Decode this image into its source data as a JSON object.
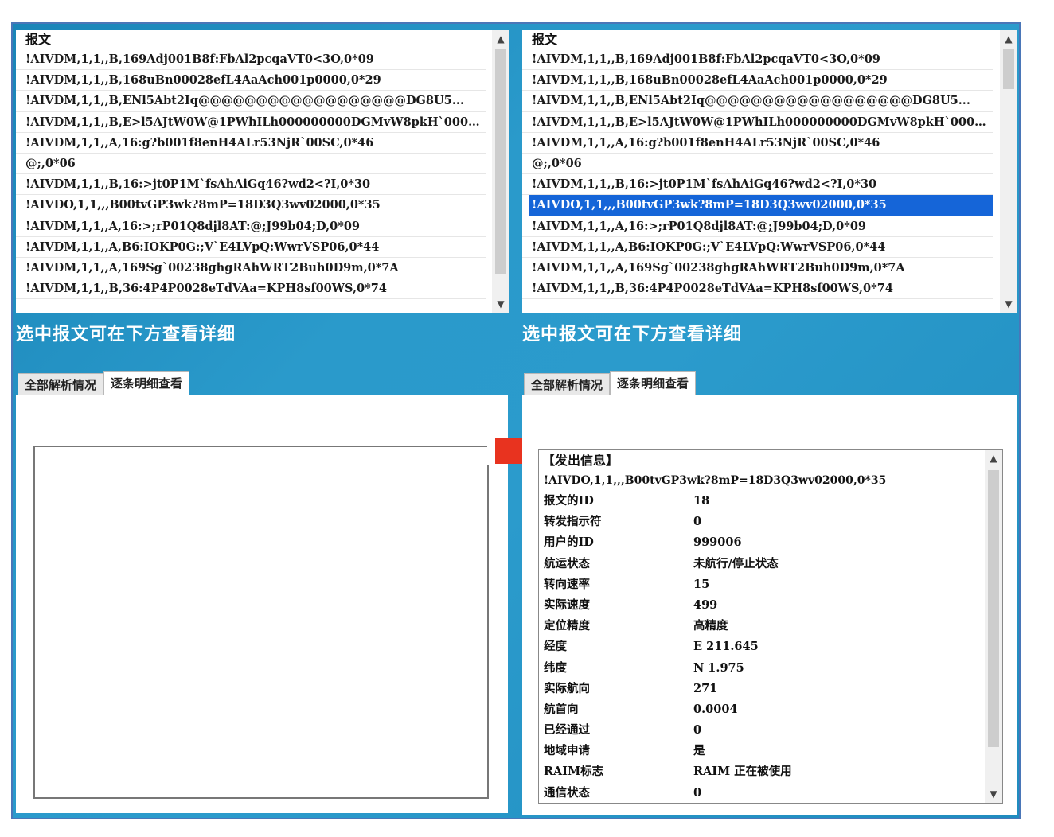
{
  "left_panel": {
    "list_header": "报文",
    "messages": [
      "!AIVDM,1,1,,B,169Adj001B8f:FbAl2pcqaVT0<3O,0*09",
      "!AIVDM,1,1,,B,168uBn00028efL4AaAch001p0000,0*29",
      "!AIVDM,1,1,,B,ENl5Abt2Iq@@@@@@@@@@@@@@@@@@DG8U5...",
      "!AIVDM,1,1,,B,E>l5AJtW0W@1PWhILh000000000DGMvW8pkH`0000...",
      "!AIVDM,1,1,,A,16:g?b001f8enH4ALr53NjR`00SC,0*46",
      "@;,0*06",
      "!AIVDM,1,1,,B,16:>jt0P1M`fsAhAiGq46?wd2<?I,0*30",
      "!AIVDO,1,1,,,B00tvGP3wk?8mP=18D3Q3wv02000,0*35",
      "!AIVDM,1,1,,A,16:>;rP01Q8djl8AT:@;J99b04;D,0*09",
      "!AIVDM,1,1,,A,B6:IOKP0G:;V`E4LVpQ:WwrVSP06,0*44",
      "!AIVDM,1,1,,A,169Sg`00238ghgRAhWRT2Buh0D9m,0*7A",
      "!AIVDM,1,1,,B,36:4P4P0028eTdVAa=KPH8sf00WS,0*74"
    ],
    "caption": "选中报文可在下方查看详细",
    "tabs": [
      "全部解析情况",
      "逐条明细查看"
    ]
  },
  "right_panel": {
    "list_header": "报文",
    "messages": [
      "!AIVDM,1,1,,B,169Adj001B8f:FbAl2pcqaVT0<3O,0*09",
      "!AIVDM,1,1,,B,168uBn00028efL4AaAch001p0000,0*29",
      "!AIVDM,1,1,,B,ENl5Abt2Iq@@@@@@@@@@@@@@@@@@DG8U5...",
      "!AIVDM,1,1,,B,E>l5AJtW0W@1PWhILh000000000DGMvW8pkH`0000...",
      "!AIVDM,1,1,,A,16:g?b001f8enH4ALr53NjR`00SC,0*46",
      "@;,0*06",
      "!AIVDM,1,1,,B,16:>jt0P1M`fsAhAiGq46?wd2<?I,0*30",
      "!AIVDO,1,1,,,B00tvGP3wk?8mP=18D3Q3wv02000,0*35",
      "!AIVDM,1,1,,A,16:>;rP01Q8djl8AT:@;J99b04;D,0*09",
      "!AIVDM,1,1,,A,B6:IOKP0G:;V`E4LVpQ:WwrVSP06,0*44",
      "!AIVDM,1,1,,A,169Sg`00238ghgRAhWRT2Buh0D9m,0*7A",
      "!AIVDM,1,1,,B,36:4P4P0028eTdVAa=KPH8sf00WS,0*74"
    ],
    "selected_index": 7,
    "caption": "选中报文可在下方查看详细",
    "tabs": [
      "全部解析情况",
      "逐条明细查看"
    ],
    "detail": {
      "header": "【发出信息】",
      "raw": "!AIVDO,1,1,,,B00tvGP3wk?8mP=18D3Q3wv02000,0*35",
      "fields": [
        {
          "k": "报文的ID",
          "v": "18"
        },
        {
          "k": "转发指示符",
          "v": "0"
        },
        {
          "k": "用户的ID",
          "v": "999006"
        },
        {
          "k": "航运状态",
          "v": "未航行/停止状态"
        },
        {
          "k": "转向速率",
          "v": "15"
        },
        {
          "k": "实际速度",
          "v": "499"
        },
        {
          "k": "定位精度",
          "v": "高精度"
        },
        {
          "k": "经度",
          "v": "E 211.645"
        },
        {
          "k": "纬度",
          "v": "N 1.975"
        },
        {
          "k": "实际航向",
          "v": "271"
        },
        {
          "k": "航首向",
          "v": "0.0004"
        },
        {
          "k": "已经通过",
          "v": "0"
        },
        {
          "k": "地域申请",
          "v": "是"
        },
        {
          "k": "RAIM标志",
          "v": "RAIM 正在被使用"
        },
        {
          "k": "通信状态",
          "v": "0"
        }
      ]
    }
  },
  "colors": {
    "frame_border": "#4a76b8",
    "background_blue": "#2a9acb",
    "selection": "#1565d8",
    "arrow": "#e8331f"
  },
  "icons": [
    "scroll-up-icon",
    "scroll-down-icon",
    "right-arrow-icon"
  ]
}
